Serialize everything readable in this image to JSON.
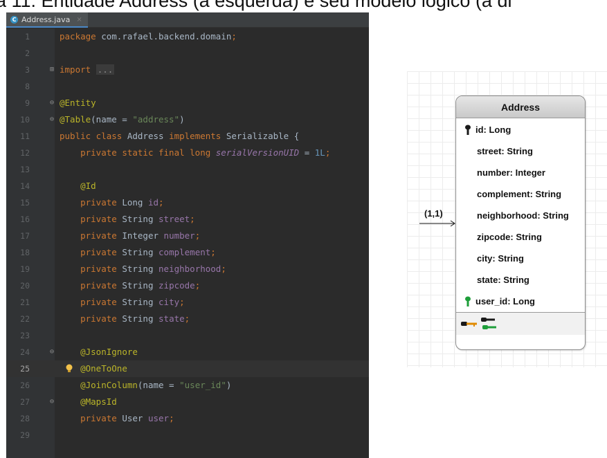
{
  "caption": "a 11. Entidade Address (à esquerda) e seu modelo lógico (à di",
  "ide": {
    "tab": {
      "icon": "C",
      "label": "Address.java",
      "close": "×"
    },
    "current_line": 25
  },
  "code_lines": [
    {
      "n": "1",
      "fold": "",
      "bulb": false,
      "tokens": [
        [
          "kw",
          "package "
        ],
        [
          "p",
          "com.rafael.backend.domain"
        ],
        [
          "kw",
          ";"
        ]
      ]
    },
    {
      "n": "2",
      "fold": "",
      "bulb": false,
      "tokens": []
    },
    {
      "n": "3",
      "fold": "⊞",
      "bulb": false,
      "tokens": [
        [
          "kw",
          "import "
        ],
        [
          "dots",
          "..."
        ]
      ]
    },
    {
      "n": "8",
      "fold": "",
      "bulb": false,
      "tokens": []
    },
    {
      "n": "9",
      "fold": "⊖",
      "bulb": false,
      "tokens": [
        [
          "an",
          "@Entity"
        ]
      ]
    },
    {
      "n": "10",
      "fold": "⊖",
      "bulb": false,
      "tokens": [
        [
          "an",
          "@Table"
        ],
        [
          "p",
          "(name = "
        ],
        [
          "str",
          "\"address\""
        ],
        [
          "p",
          ")"
        ]
      ]
    },
    {
      "n": "11",
      "fold": "",
      "bulb": false,
      "tokens": [
        [
          "kw",
          "public class "
        ],
        [
          "p",
          "Address "
        ],
        [
          "kw",
          "implements "
        ],
        [
          "p",
          "Serializable {"
        ]
      ]
    },
    {
      "n": "12",
      "fold": "",
      "bulb": false,
      "tokens": [
        [
          "p",
          "    "
        ],
        [
          "kw",
          "private static final long "
        ],
        [
          "cst",
          "serialVersionUID"
        ],
        [
          "p",
          " = "
        ],
        [
          "num",
          "1L"
        ],
        [
          "kw",
          ";"
        ]
      ]
    },
    {
      "n": "13",
      "fold": "",
      "bulb": false,
      "tokens": []
    },
    {
      "n": "14",
      "fold": "",
      "bulb": false,
      "tokens": [
        [
          "p",
          "    "
        ],
        [
          "an",
          "@Id"
        ]
      ]
    },
    {
      "n": "15",
      "fold": "",
      "bulb": false,
      "tokens": [
        [
          "p",
          "    "
        ],
        [
          "kw",
          "private "
        ],
        [
          "p",
          "Long "
        ],
        [
          "fld",
          "id"
        ],
        [
          "kw",
          ";"
        ]
      ]
    },
    {
      "n": "16",
      "fold": "",
      "bulb": false,
      "tokens": [
        [
          "p",
          "    "
        ],
        [
          "kw",
          "private "
        ],
        [
          "p",
          "String "
        ],
        [
          "fld",
          "street"
        ],
        [
          "kw",
          ";"
        ]
      ]
    },
    {
      "n": "17",
      "fold": "",
      "bulb": false,
      "tokens": [
        [
          "p",
          "    "
        ],
        [
          "kw",
          "private "
        ],
        [
          "p",
          "Integer "
        ],
        [
          "fld",
          "number"
        ],
        [
          "kw",
          ";"
        ]
      ]
    },
    {
      "n": "18",
      "fold": "",
      "bulb": false,
      "tokens": [
        [
          "p",
          "    "
        ],
        [
          "kw",
          "private "
        ],
        [
          "p",
          "String "
        ],
        [
          "fld",
          "complement"
        ],
        [
          "kw",
          ";"
        ]
      ]
    },
    {
      "n": "19",
      "fold": "",
      "bulb": false,
      "tokens": [
        [
          "p",
          "    "
        ],
        [
          "kw",
          "private "
        ],
        [
          "p",
          "String "
        ],
        [
          "fld",
          "neighborhood"
        ],
        [
          "kw",
          ";"
        ]
      ]
    },
    {
      "n": "20",
      "fold": "",
      "bulb": false,
      "tokens": [
        [
          "p",
          "    "
        ],
        [
          "kw",
          "private "
        ],
        [
          "p",
          "String "
        ],
        [
          "fld",
          "zipcode"
        ],
        [
          "kw",
          ";"
        ]
      ]
    },
    {
      "n": "21",
      "fold": "",
      "bulb": false,
      "tokens": [
        [
          "p",
          "    "
        ],
        [
          "kw",
          "private "
        ],
        [
          "p",
          "String "
        ],
        [
          "fld",
          "city"
        ],
        [
          "kw",
          ";"
        ]
      ]
    },
    {
      "n": "22",
      "fold": "",
      "bulb": false,
      "tokens": [
        [
          "p",
          "    "
        ],
        [
          "kw",
          "private "
        ],
        [
          "p",
          "String "
        ],
        [
          "fld",
          "state"
        ],
        [
          "kw",
          ";"
        ]
      ]
    },
    {
      "n": "23",
      "fold": "",
      "bulb": false,
      "tokens": []
    },
    {
      "n": "24",
      "fold": "⊖",
      "bulb": false,
      "tokens": [
        [
          "p",
          "    "
        ],
        [
          "an",
          "@JsonIgnore"
        ]
      ]
    },
    {
      "n": "25",
      "fold": "",
      "bulb": true,
      "tokens": [
        [
          "p",
          "    "
        ],
        [
          "an",
          "@OneToOne"
        ]
      ]
    },
    {
      "n": "26",
      "fold": "",
      "bulb": false,
      "tokens": [
        [
          "p",
          "    "
        ],
        [
          "an",
          "@JoinColumn"
        ],
        [
          "p",
          "(name = "
        ],
        [
          "str",
          "\"user_id\""
        ],
        [
          "p",
          ")"
        ]
      ]
    },
    {
      "n": "27",
      "fold": "⊖",
      "bulb": false,
      "tokens": [
        [
          "p",
          "    "
        ],
        [
          "an",
          "@MapsId"
        ]
      ]
    },
    {
      "n": "28",
      "fold": "",
      "bulb": false,
      "tokens": [
        [
          "p",
          "    "
        ],
        [
          "kw",
          "private "
        ],
        [
          "p",
          "User "
        ],
        [
          "fld",
          "user"
        ],
        [
          "kw",
          ";"
        ]
      ]
    },
    {
      "n": "29",
      "fold": "",
      "bulb": false,
      "tokens": []
    }
  ],
  "er": {
    "entity_title": "Address",
    "relationship_label": "(1,1)",
    "attributes": [
      {
        "label": "id: Long",
        "key": "primary"
      },
      {
        "label": "street: String",
        "key": ""
      },
      {
        "label": "number: Integer",
        "key": ""
      },
      {
        "label": "complement: String",
        "key": ""
      },
      {
        "label": "neighborhood: String",
        "key": ""
      },
      {
        "label": "zipcode: String",
        "key": ""
      },
      {
        "label": "city: String",
        "key": ""
      },
      {
        "label": "state: String",
        "key": ""
      },
      {
        "label": "user_id: Long",
        "key": "foreign"
      }
    ],
    "footer_icons": [
      "key-icon",
      "primary-foreign-key-icon"
    ],
    "colors": {
      "primary_key": "#1a1a1a",
      "foreign_key": "#1e9e3a",
      "key_orange": "#e08a00"
    }
  }
}
